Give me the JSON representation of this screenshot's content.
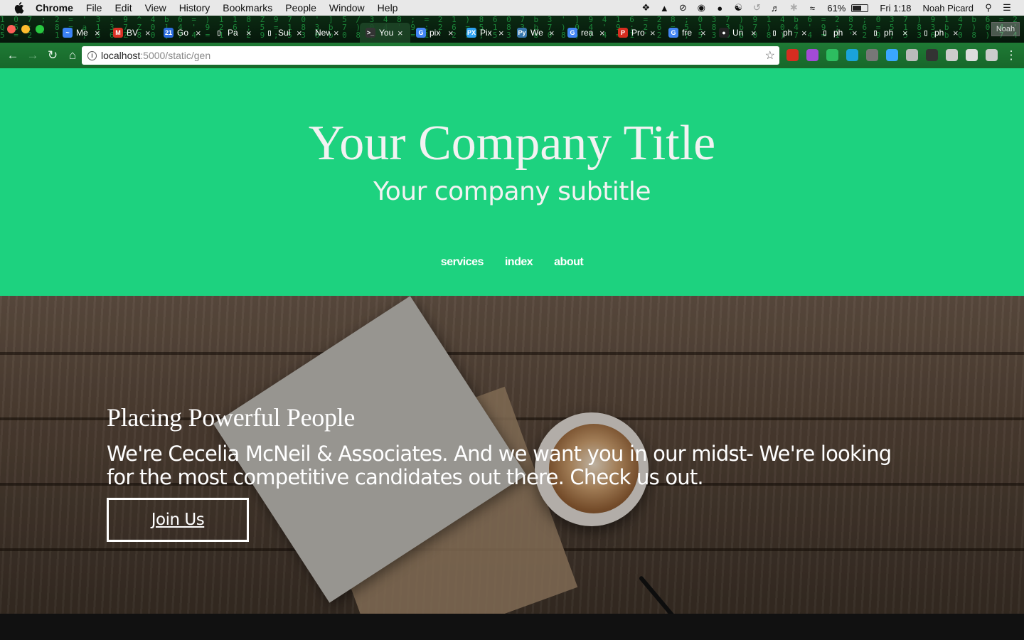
{
  "menubar": {
    "app": "Chrome",
    "items": [
      "File",
      "Edit",
      "View",
      "History",
      "Bookmarks",
      "People",
      "Window",
      "Help"
    ],
    "status_icons": [
      "dropbox-icon",
      "drive-icon",
      "blocked-icon",
      "creative-cloud-icon",
      "chat-icon",
      "accessibility-icon",
      "time-machine-icon",
      "volume-icon",
      "bluetooth-icon",
      "wifi-icon"
    ],
    "battery_percent": "61%",
    "battery_level": 0.61,
    "clock": "Fri 1:18",
    "user": "Noah Picard"
  },
  "browser": {
    "tabs": [
      {
        "label": "Me",
        "icon": "messenger-icon",
        "color": "#3b82f6",
        "glyph": "~"
      },
      {
        "label": "BV",
        "icon": "gmail-icon",
        "color": "#d93025",
        "glyph": "M"
      },
      {
        "label": "Go",
        "icon": "calendar-icon",
        "color": "#2b6de0",
        "glyph": "21"
      },
      {
        "label": "Pa",
        "icon": "document-icon",
        "color": "transparent",
        "glyph": "▯"
      },
      {
        "label": "Sul",
        "icon": "document-icon",
        "color": "transparent",
        "glyph": "▯"
      },
      {
        "label": "New T",
        "icon": "",
        "color": "transparent",
        "glyph": ""
      },
      {
        "label": "You",
        "icon": "terminal-icon",
        "color": "#333",
        "glyph": ">_",
        "active": true
      },
      {
        "label": "pix",
        "icon": "google-icon",
        "color": "#4285f4",
        "glyph": "G"
      },
      {
        "label": "Pix",
        "icon": "pixabay-icon",
        "color": "#2ea3f2",
        "glyph": "PX"
      },
      {
        "label": "We",
        "icon": "python-icon",
        "color": "#3776ab",
        "glyph": "Py"
      },
      {
        "label": "rea",
        "icon": "google-icon",
        "color": "#4285f4",
        "glyph": "G"
      },
      {
        "label": "Pro",
        "icon": "product-icon",
        "color": "#d62d20",
        "glyph": "P"
      },
      {
        "label": "fre",
        "icon": "google-icon",
        "color": "#4285f4",
        "glyph": "G"
      },
      {
        "label": "Un",
        "icon": "github-icon",
        "color": "#222",
        "glyph": "●"
      },
      {
        "label": "ph",
        "icon": "document-icon",
        "color": "transparent",
        "glyph": "▯"
      },
      {
        "label": "ph",
        "icon": "document-icon",
        "color": "transparent",
        "glyph": "▯"
      },
      {
        "label": "ph",
        "icon": "document-icon",
        "color": "transparent",
        "glyph": "▯"
      },
      {
        "label": "ph",
        "icon": "document-icon",
        "color": "transparent",
        "glyph": "▯"
      }
    ],
    "profile": "Noah",
    "url_host": "localhost",
    "url_path": ":5000/static/gen",
    "extensions": [
      {
        "icon": "opera-icon",
        "color": "#d62d20"
      },
      {
        "icon": "color-wheel-icon",
        "color": "#a24bd6"
      },
      {
        "icon": "evernote-icon",
        "color": "#2dbe60"
      },
      {
        "icon": "eye-icon",
        "color": "#1aa3d9"
      },
      {
        "icon": "incognito-icon",
        "color": "#777"
      },
      {
        "icon": "diamond-icon",
        "color": "#3aa7ff"
      },
      {
        "icon": "crx-icon",
        "color": "#bbb"
      },
      {
        "icon": "screen-icon",
        "color": "#333"
      },
      {
        "icon": "r-icon",
        "color": "#ccc"
      },
      {
        "icon": "drive-icon",
        "color": "#ddd"
      },
      {
        "icon": "n-icon",
        "color": "#ccc"
      }
    ]
  },
  "site": {
    "accent": "#1dd27f",
    "title": "Your Company Title",
    "subtitle": "Your company subtitle",
    "nav": [
      "services",
      "index",
      "about"
    ],
    "hero": {
      "heading": "Placing Powerful People",
      "body": "We're Cecelia McNeil & Associates. And we want you in our midst- We're looking for the most competitive candidates out there. Check us out.",
      "cta": "Join Us"
    }
  }
}
